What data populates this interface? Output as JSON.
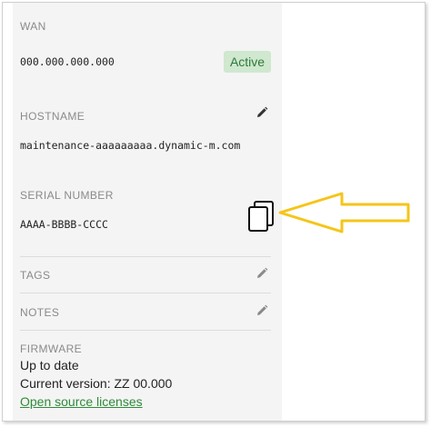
{
  "wan": {
    "label": "WAN",
    "ip": "000.000.000.000",
    "status": "Active"
  },
  "hostname": {
    "label": "HOSTNAME",
    "value": "maintenance-aaaaaaaaa.dynamic-m.com"
  },
  "serial": {
    "label": "SERIAL NUMBER",
    "value": "AAAA-BBBB-CCCC"
  },
  "tags": {
    "label": "TAGS"
  },
  "notes": {
    "label": "NOTES"
  },
  "firmware": {
    "label": "FIRMWARE",
    "status": "Up to date",
    "version": "Current version: ZZ 00.000",
    "link": "Open source licenses"
  },
  "icons": {
    "edit": "pencil-icon",
    "copy": "copy-icon",
    "pointer": "arrow-left-icon"
  },
  "colors": {
    "active_bg": "#cfe8cf",
    "active_text": "#2d7a3a",
    "link": "#2e8b3a",
    "arrow": "#f5c518"
  }
}
